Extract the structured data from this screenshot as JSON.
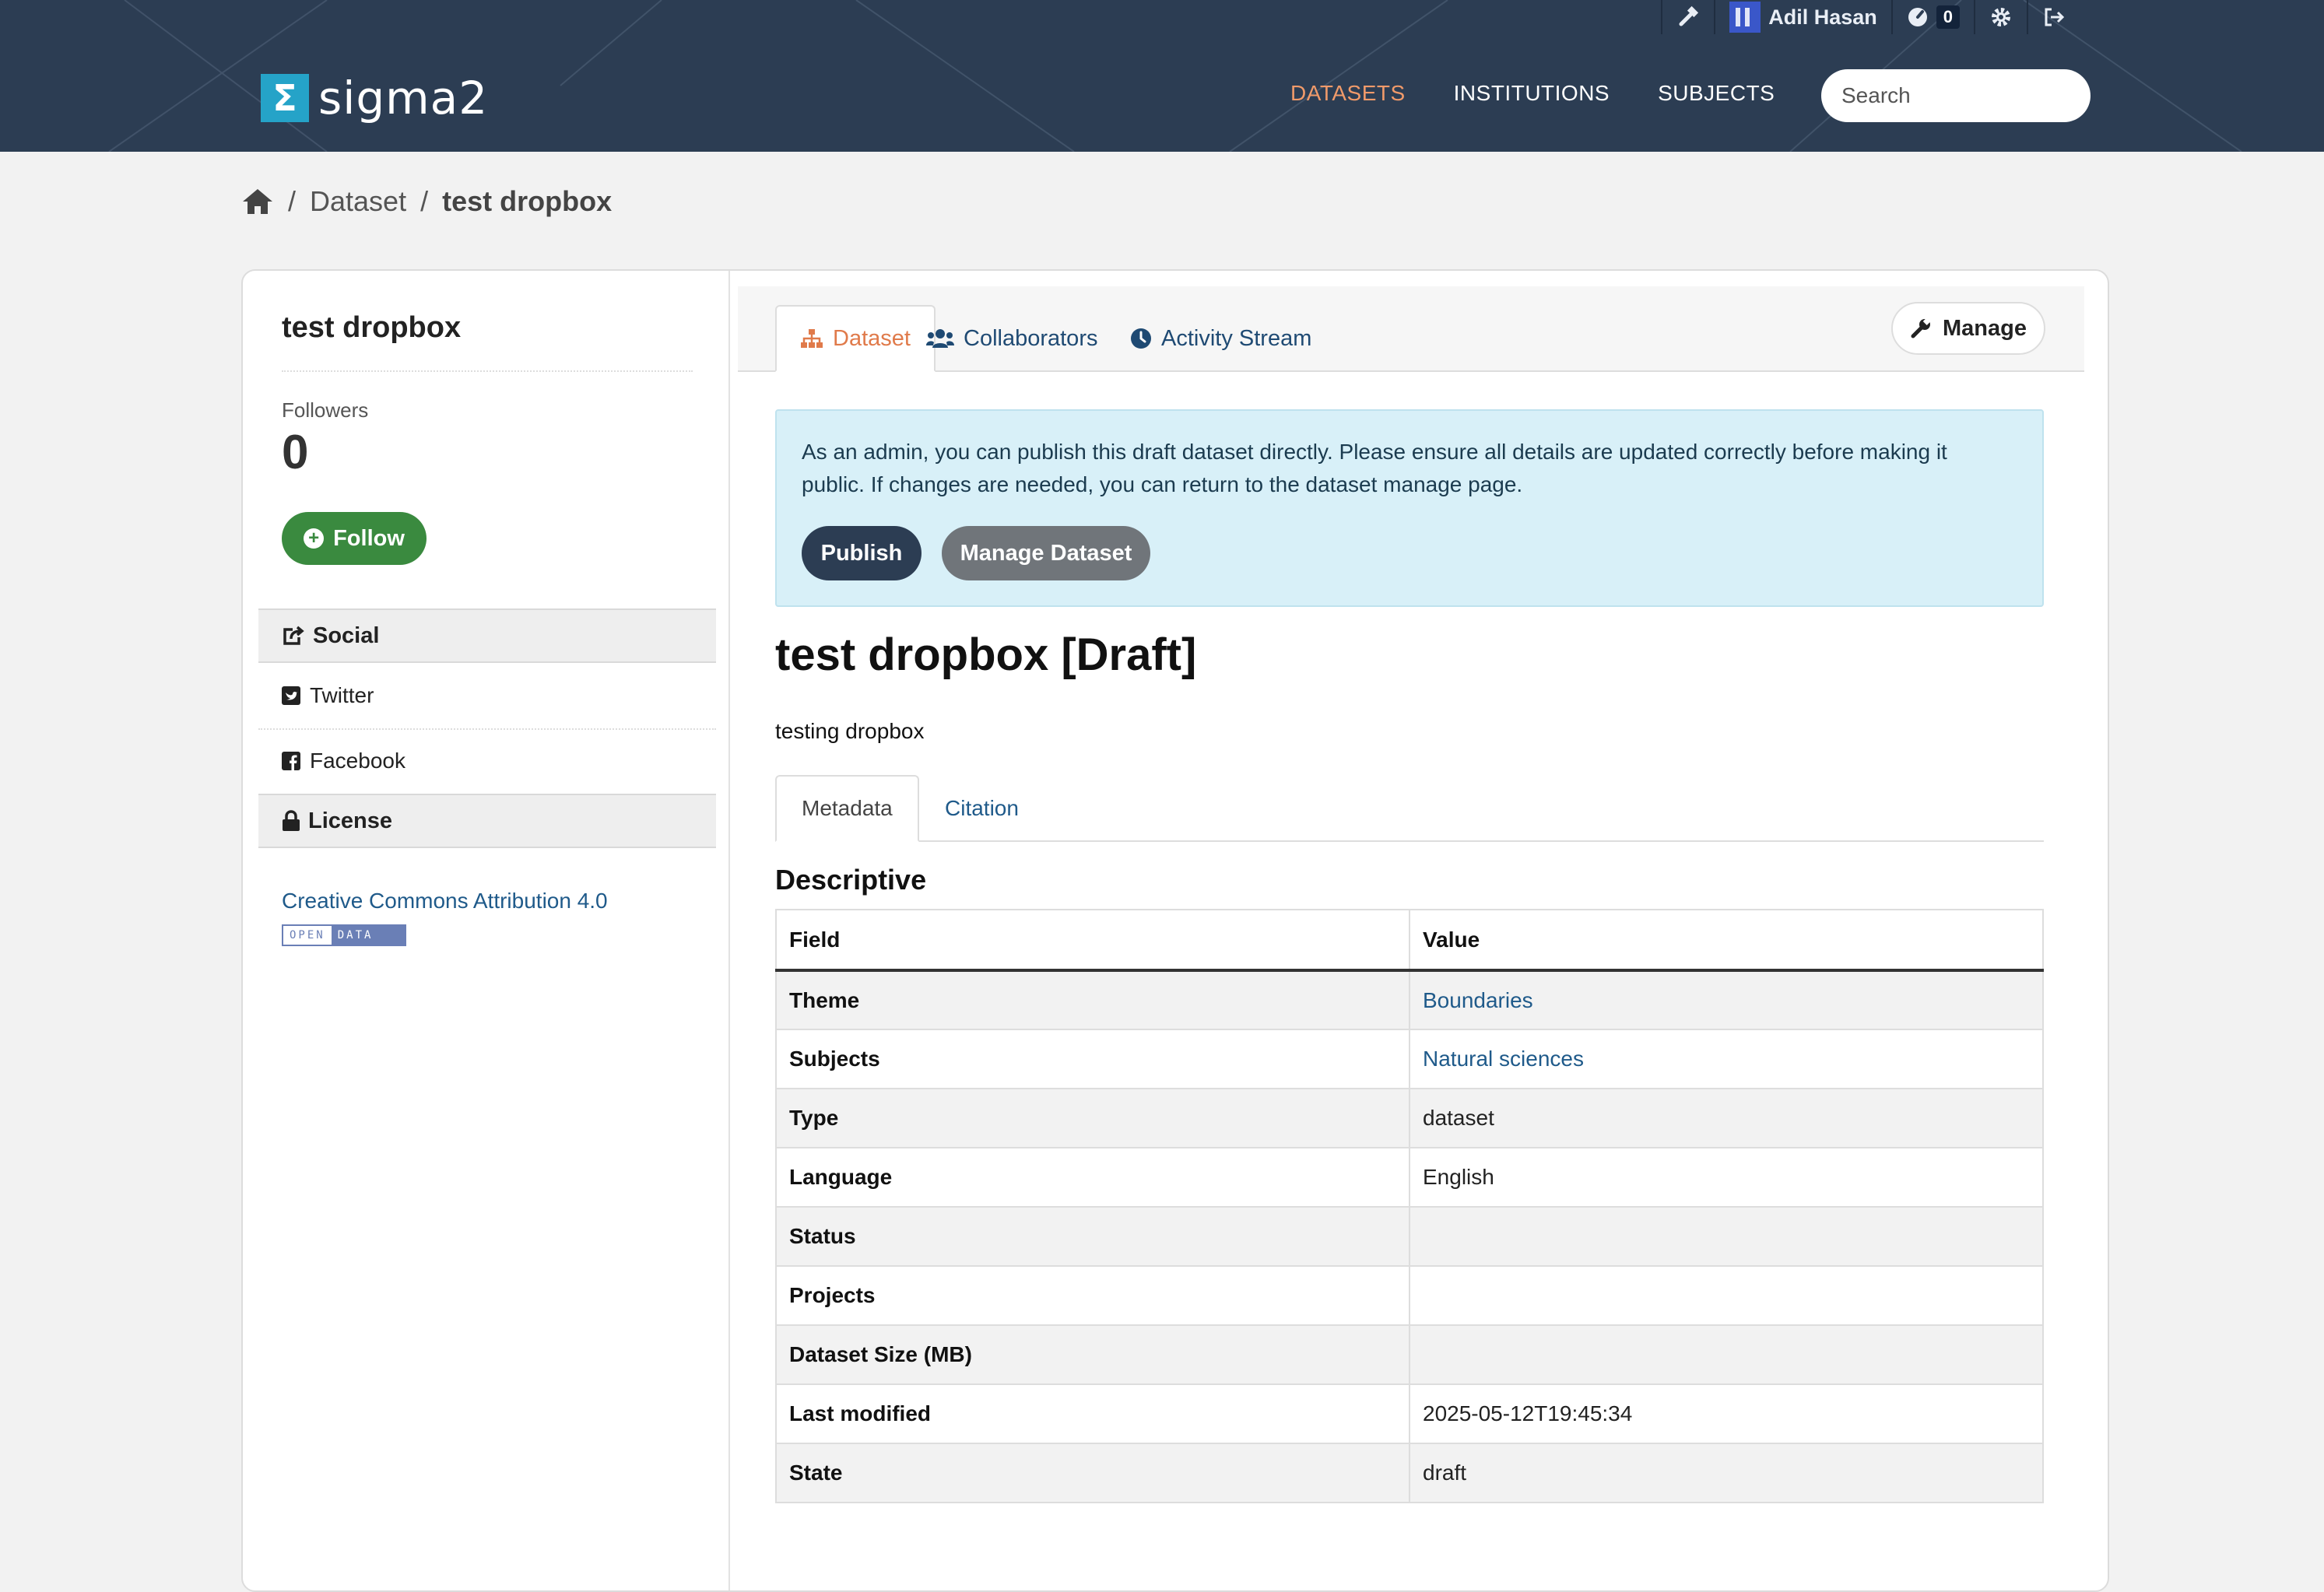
{
  "header": {
    "logo_text": "sigma2",
    "logo_symbol": "Σ",
    "nav": [
      {
        "label": "DATASETS",
        "active": true
      },
      {
        "label": "INSTITUTIONS",
        "active": false
      },
      {
        "label": "SUBJECTS",
        "active": false
      }
    ],
    "search_placeholder": "Search",
    "account": {
      "user_name": "Adil Hasan",
      "activity_count": "0"
    },
    "colors": {
      "bar": "#2c3d53",
      "active_nav": "#f09a6a"
    }
  },
  "breadcrumb": {
    "section": "Dataset",
    "current": "test dropbox"
  },
  "sidebar": {
    "title": "test dropbox",
    "followers_label": "Followers",
    "followers_count": "0",
    "follow_label": "Follow",
    "social_heading": "Social",
    "social_links": [
      "Twitter",
      "Facebook"
    ],
    "license_heading": "License",
    "license_link": "Creative Commons Attribution 4.0",
    "open_data_badge": {
      "left": "OPEN",
      "right": "DATA"
    }
  },
  "tabs": [
    {
      "label": "Dataset",
      "icon": "sitemap-icon",
      "active": true
    },
    {
      "label": "Collaborators",
      "icon": "users-icon",
      "active": false
    },
    {
      "label": "Activity Stream",
      "icon": "clock-icon",
      "active": false
    }
  ],
  "manage_label": "Manage",
  "alert": {
    "text": "As an admin, you can publish this draft dataset directly. Please ensure all details are updated correctly before making it public. If changes are needed, you can return to the dataset manage page.",
    "publish_label": "Publish",
    "manage_dataset_label": "Manage Dataset"
  },
  "dataset": {
    "title": "test dropbox [Draft]",
    "description": "testing dropbox",
    "subtabs": [
      "Metadata",
      "Citation"
    ],
    "section_heading": "Descriptive",
    "table_headers": [
      "Field",
      "Value"
    ],
    "rows": [
      {
        "field": "Theme",
        "value": "Boundaries",
        "link": true
      },
      {
        "field": "Subjects",
        "value": "Natural sciences",
        "link": true
      },
      {
        "field": "Type",
        "value": "dataset",
        "link": false
      },
      {
        "field": "Language",
        "value": "English",
        "link": false
      },
      {
        "field": "Status",
        "value": "",
        "link": false
      },
      {
        "field": "Projects",
        "value": "",
        "link": false
      },
      {
        "field": "Dataset Size (MB)",
        "value": "",
        "link": false
      },
      {
        "field": "Last modified",
        "value": "2025-05-12T19:45:34",
        "link": false
      },
      {
        "field": "State",
        "value": "draft",
        "link": false
      }
    ]
  }
}
